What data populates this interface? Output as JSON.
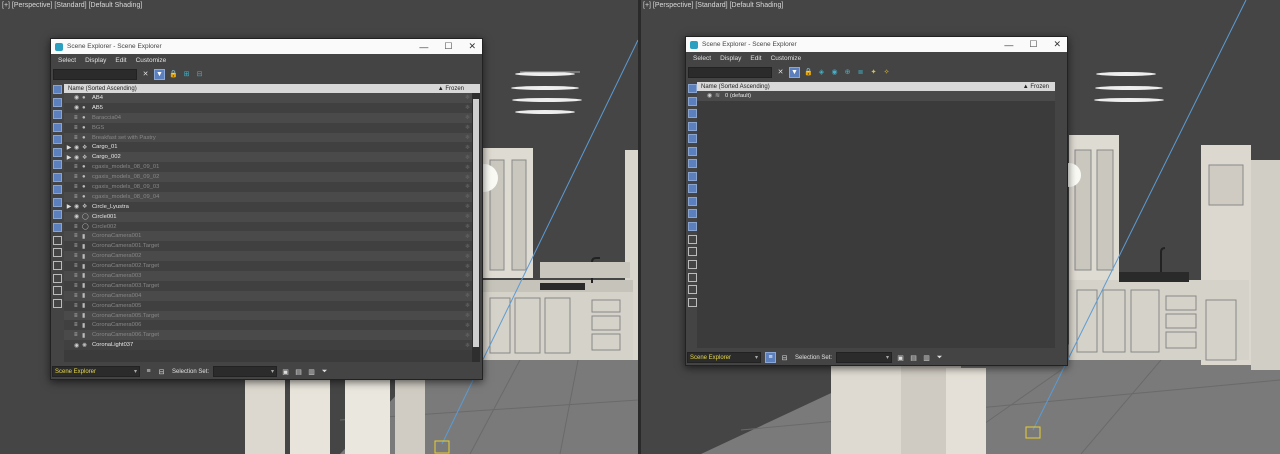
{
  "viewport_left": {
    "label": "[+] [Perspective] [Standard] [Default Shading]"
  },
  "viewport_right": {
    "label": "[+] [Perspective] [Standard] [Default Shading]"
  },
  "explorer_left": {
    "title": "Scene Explorer - Scene Explorer",
    "menu": [
      "Select",
      "Display",
      "Edit",
      "Customize"
    ],
    "search_value": "",
    "list_header": {
      "name_col": "Name (Sorted Ascending)",
      "frozen_col": "▲ Frozen"
    },
    "rows": [
      {
        "name": "AB4",
        "visible": true,
        "expandable": false,
        "icon": "sphere-icon"
      },
      {
        "name": "AB5",
        "visible": true,
        "expandable": false,
        "icon": "sphere-icon"
      },
      {
        "name": "Baraccia04",
        "visible": false,
        "expandable": false,
        "icon": "sphere-icon"
      },
      {
        "name": "BGS",
        "visible": false,
        "expandable": false,
        "icon": "sphere-icon"
      },
      {
        "name": "Breakfast set with Pastry",
        "visible": false,
        "expandable": false,
        "icon": "sphere-icon"
      },
      {
        "name": "Cargo_01",
        "visible": true,
        "expandable": true,
        "icon": "group-icon"
      },
      {
        "name": "Cargo_002",
        "visible": true,
        "expandable": true,
        "icon": "group-icon"
      },
      {
        "name": "cgaxis_models_08_09_01",
        "visible": false,
        "expandable": false,
        "icon": "sphere-icon"
      },
      {
        "name": "cgaxis_models_08_09_02",
        "visible": false,
        "expandable": false,
        "icon": "sphere-icon"
      },
      {
        "name": "cgaxis_models_08_09_03",
        "visible": false,
        "expandable": false,
        "icon": "sphere-icon"
      },
      {
        "name": "cgaxis_models_08_09_04",
        "visible": false,
        "expandable": false,
        "icon": "sphere-icon"
      },
      {
        "name": "Circle_Lyustra",
        "visible": true,
        "expandable": true,
        "icon": "group-icon"
      },
      {
        "name": "Circle001",
        "visible": true,
        "expandable": false,
        "icon": "shape-icon"
      },
      {
        "name": "Circle002",
        "visible": false,
        "expandable": false,
        "icon": "shape-icon"
      },
      {
        "name": "CoronaCamera001",
        "visible": false,
        "expandable": false,
        "icon": "camera-icon"
      },
      {
        "name": "CoronaCamera001.Target",
        "visible": false,
        "expandable": false,
        "icon": "camera-icon"
      },
      {
        "name": "CoronaCamera002",
        "visible": false,
        "expandable": false,
        "icon": "camera-icon"
      },
      {
        "name": "CoronaCamera002.Target",
        "visible": false,
        "expandable": false,
        "icon": "camera-icon"
      },
      {
        "name": "CoronaCamera003",
        "visible": false,
        "expandable": false,
        "icon": "camera-icon"
      },
      {
        "name": "CoronaCamera003.Target",
        "visible": false,
        "expandable": false,
        "icon": "camera-icon"
      },
      {
        "name": "CoronaCamera004",
        "visible": false,
        "expandable": false,
        "icon": "camera-icon"
      },
      {
        "name": "CoronaCamera005",
        "visible": false,
        "expandable": false,
        "icon": "camera-icon"
      },
      {
        "name": "CoronaCamera005.Target",
        "visible": false,
        "expandable": false,
        "icon": "camera-icon"
      },
      {
        "name": "CoronaCamera006",
        "visible": false,
        "expandable": false,
        "icon": "camera-icon"
      },
      {
        "name": "CoronaCamera006.Target",
        "visible": false,
        "expandable": false,
        "icon": "camera-icon"
      },
      {
        "name": "CoronaLight037",
        "visible": true,
        "expandable": false,
        "icon": "light-icon"
      }
    ],
    "mode_select": "Scene Explorer",
    "selection_set_label": "Selection Set:",
    "selection_set_value": ""
  },
  "explorer_right": {
    "title": "Scene Explorer - Scene Explorer",
    "menu": [
      "Select",
      "Display",
      "Edit",
      "Customize"
    ],
    "search_value": "",
    "list_header": {
      "name_col": "Name (Sorted Ascending)",
      "frozen_col": "▲ Frozen"
    },
    "rows": [
      {
        "name": "0 (default)",
        "visible": true,
        "expandable": false,
        "icon": "layer-icon"
      }
    ],
    "mode_select": "Scene Explorer",
    "selection_set_label": "Selection Set:",
    "selection_set_value": ""
  },
  "colors": {
    "accent": "#5c7fbd",
    "mode_text": "#e6d84a",
    "viewport_bg": "#454545",
    "panel_bg": "#444444"
  }
}
